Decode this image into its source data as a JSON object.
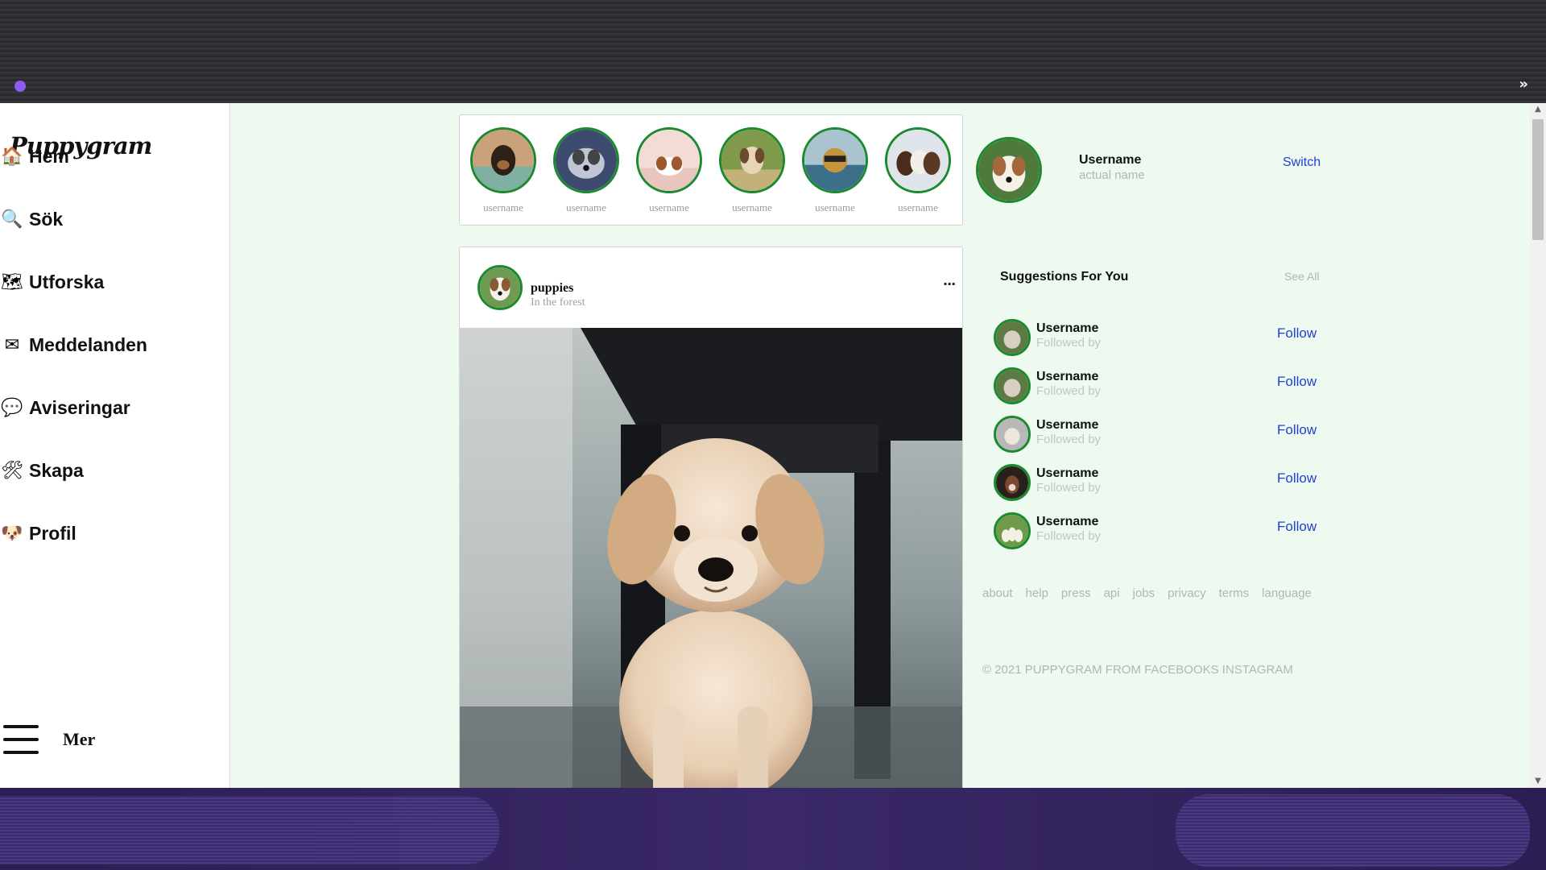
{
  "app": {
    "logo": "Puppygram"
  },
  "browser": {
    "overflow_label": "»"
  },
  "sidebar": {
    "items": [
      {
        "label": "Hem",
        "icon": "home-icon",
        "glyph": "🏠"
      },
      {
        "label": "Sök",
        "icon": "search-icon",
        "glyph": "🔍"
      },
      {
        "label": "Utforska",
        "icon": "map-icon",
        "glyph": "🗺"
      },
      {
        "label": "Meddelanden",
        "icon": "envelope-icon",
        "glyph": "✉"
      },
      {
        "label": "Aviseringar",
        "icon": "speech-bubble-icon",
        "glyph": "💬"
      },
      {
        "label": "Skapa",
        "icon": "tools-icon",
        "glyph": "🛠"
      },
      {
        "label": "Profil",
        "icon": "dog-face-icon",
        "glyph": "🐶"
      }
    ],
    "more_label": "Mer"
  },
  "stories": [
    {
      "username": "username"
    },
    {
      "username": "username"
    },
    {
      "username": "username"
    },
    {
      "username": "username"
    },
    {
      "username": "username"
    },
    {
      "username": "username"
    }
  ],
  "post": {
    "author": "puppies",
    "location": "In the forest",
    "more_label": "···"
  },
  "profile": {
    "username": "Username",
    "actual_name": "actual name",
    "switch_label": "Switch"
  },
  "suggestions": {
    "title": "Suggestions For You",
    "see_all": "See All",
    "items": [
      {
        "username": "Username",
        "followed_by": "Followed by",
        "action": "Follow"
      },
      {
        "username": "Username",
        "followed_by": "Followed by",
        "action": "Follow"
      },
      {
        "username": "Username",
        "followed_by": "Followed by",
        "action": "Follow"
      },
      {
        "username": "Username",
        "followed_by": "Followed by",
        "action": "Follow"
      },
      {
        "username": "Username",
        "followed_by": "Followed by",
        "action": "Follow"
      }
    ]
  },
  "footer": {
    "links": [
      "about",
      "help",
      "press",
      "api",
      "jobs",
      "privacy",
      "terms",
      "language"
    ],
    "copyright": "© 2021 PUPPYGRAM FROM FACEBOOKS INSTAGRAM"
  },
  "colors": {
    "accent_ring": "#1b8a2f",
    "link_blue": "#1f3fd6",
    "feed_bg": "#eefaf0",
    "muted": "#b4b4b4"
  }
}
